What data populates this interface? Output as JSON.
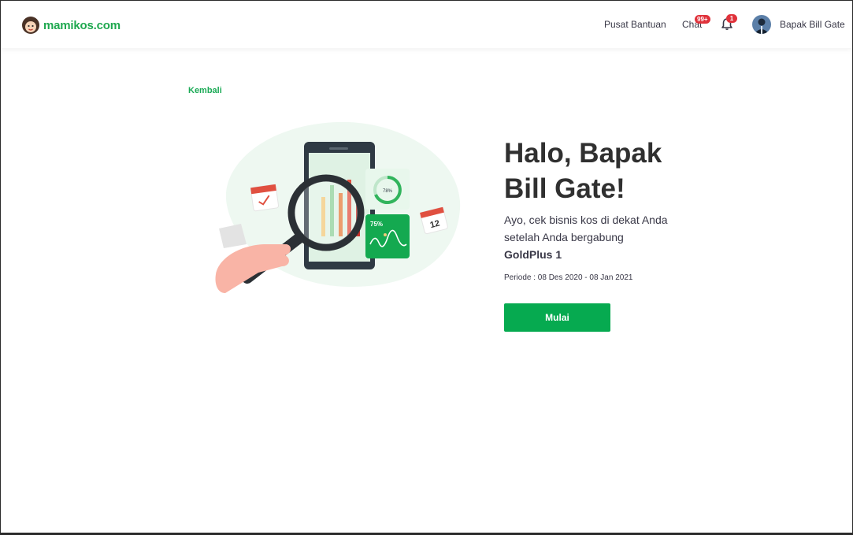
{
  "header": {
    "logo_text": "mamikos.com",
    "help_label": "Pusat Bantuan",
    "chat_label": "Chat",
    "chat_badge": "99+",
    "notif_badge": "1",
    "user_name": "Bapak Bill Gate"
  },
  "main": {
    "back_label": "Kembali",
    "greeting": "Halo, Bapak Bill Gate!",
    "description": "Ayo, cek bisnis kos di dekat Anda setelah Anda bergabung",
    "package": "GoldPlus 1",
    "period": "Periode : 08 Des 2020 - 08 Jan 2021",
    "start_button": "Mulai"
  },
  "illustration": {
    "gauge_label": "78%",
    "chart_label": "75%",
    "calendar_number": "12"
  },
  "colors": {
    "brand": "#1fa84f",
    "button": "#06aa50",
    "badge": "#e0323b"
  }
}
